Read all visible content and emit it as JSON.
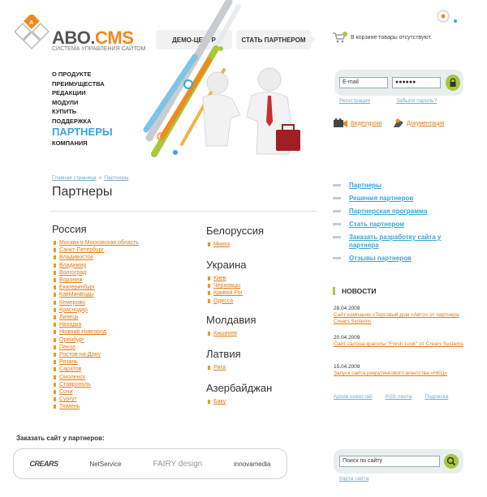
{
  "header": {
    "brand_main": "ABO.",
    "brand_accent": "CMS",
    "tagline": "СИСТЕМА УПРАВЛЕНИЯ САЙТОМ",
    "tabs": [
      "ДЕМО-ЦЕНТР",
      "СТАТЬ ПАРТНЕРОМ"
    ],
    "cart_text": "В корзине товары отсутствуют."
  },
  "nav": {
    "items": [
      "О ПРОДУКТЕ",
      "ПРЕИМУЩЕСТВА",
      "РЕДАКЦИИ",
      "МОДУЛИ",
      "КУПИТЬ",
      "ПОДДЕРЖКА",
      "ПАРТНЕРЫ",
      "КОМПАНИЯ"
    ],
    "active_index": 6
  },
  "login": {
    "email_placeholder": "E-mail",
    "password_value": "●●●●●●",
    "register_label": "Регистрация",
    "forgot_label": "Забыли пароль?",
    "video_label": "Видеоуроки",
    "docs_label": "Документация"
  },
  "breadcrumb": {
    "home": "Главная страница",
    "sep": "»",
    "current": "Партнеры"
  },
  "page_title": "Партнеры",
  "regions": {
    "russia": {
      "title": "Россия",
      "cities": [
        "Москва и Московская область",
        "Санкт-Петербург",
        "Владивосток",
        "Владимир",
        "Волгоград",
        "Воронеж",
        "Екатеринбург",
        "КавМинВоды",
        "Кемерово",
        "Краснодар",
        "Липецк",
        "Находка",
        "Нижний Новгород",
        "Оренбург",
        "Пенза",
        "Ростов-на-Дону",
        "Рязань",
        "Саратов",
        "Смоленск",
        "Ставрополь",
        "Сочи",
        "Сургут",
        "Тюмень"
      ]
    },
    "belarus": {
      "title": "Белоруссия",
      "cities": [
        "Минск"
      ]
    },
    "ukraine": {
      "title": "Украина",
      "cities": [
        "Киев",
        "Черновцы",
        "Кривой Рог",
        "Одесса"
      ]
    },
    "moldova": {
      "title": "Молдавия",
      "cities": [
        "Кишинев"
      ]
    },
    "latvia": {
      "title": "Латвия",
      "cities": [
        "Рига"
      ]
    },
    "azerbaijan": {
      "title": "Азербайджан",
      "cities": [
        "Баку"
      ]
    }
  },
  "side_nav": [
    "Партнеры",
    "Решения партнеров",
    "Партнерская программа",
    "Стать партнером",
    "Заказать разработку сайта у партнера",
    "Отзывы партнеров"
  ],
  "news": {
    "heading": "НОВОСТИ",
    "items": [
      {
        "date": "28.04.2009",
        "text": "Сайт компании «Торговый дом «Авто» от партнера Crears Systems"
      },
      {
        "date": "20.04.2009",
        "text": "Сайт салона красоты \"Fresh Look\" от Crears Systems"
      },
      {
        "date": "15.04.2009",
        "text": "Запуск сайта рекрутингового агентства «НКЦ»"
      }
    ],
    "links": [
      "Архив новостей",
      "RSS лента",
      "Подписка"
    ]
  },
  "footer": {
    "order_heading": "Заказать сайт у партнеров:",
    "partner_logos": [
      "CREARS",
      "NetService",
      "FAIRY design",
      "innovamedia"
    ],
    "search_placeholder": "Поиск по сайту",
    "sitemap_label": "Карта сайта"
  },
  "colors": {
    "accent_orange": "#f08a1c",
    "link_blue": "#3aa5d8",
    "green": "#a8c83a"
  }
}
